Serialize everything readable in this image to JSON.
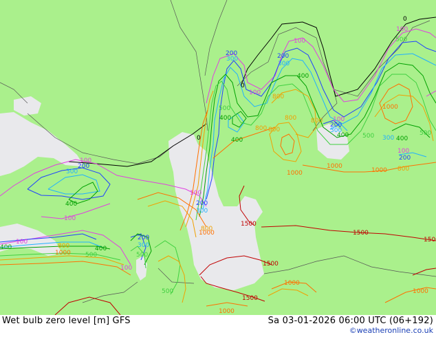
{
  "footer": {
    "product": "Wet bulb zero level [m] GFS",
    "datetime": "Sa 03-01-2026 06:00 UTC (06+192)",
    "credit": "©weatheronline.co.uk"
  },
  "colors": {
    "land": "#aaf08c",
    "sea": "#e9e9ec",
    "border": "#555555",
    "c0": "#000000",
    "c100": "#e040e0",
    "c200": "#2040ff",
    "c300": "#20b0ff",
    "c400": "#00a000",
    "c500": "#40d040",
    "c800": "#f0a000",
    "c1000": "#ff7000",
    "c1500": "#c00000"
  },
  "contour_labels": [
    {
      "text": "0",
      "level": "c0"
    },
    {
      "text": "0",
      "level": "c0"
    },
    {
      "text": "0",
      "level": "c0"
    },
    {
      "text": "100",
      "level": "c100"
    },
    {
      "text": "100",
      "level": "c100"
    },
    {
      "text": "100",
      "level": "c100"
    },
    {
      "text": "100",
      "level": "c100"
    },
    {
      "text": "100",
      "level": "c100"
    },
    {
      "text": "100",
      "level": "c100"
    },
    {
      "text": "100",
      "level": "c100"
    },
    {
      "text": "100",
      "level": "c100"
    },
    {
      "text": "100",
      "level": "c100"
    },
    {
      "text": "100",
      "level": "c100"
    },
    {
      "text": "200",
      "level": "c200"
    },
    {
      "text": "200",
      "level": "c200"
    },
    {
      "text": "200",
      "level": "c200"
    },
    {
      "text": "200",
      "level": "c200"
    },
    {
      "text": "200",
      "level": "c200"
    },
    {
      "text": "200",
      "level": "c200"
    },
    {
      "text": "200",
      "level": "c200"
    },
    {
      "text": "300",
      "level": "c300"
    },
    {
      "text": "300",
      "level": "c300"
    },
    {
      "text": "300",
      "level": "c300"
    },
    {
      "text": "300",
      "level": "c300"
    },
    {
      "text": "300",
      "level": "c300"
    },
    {
      "text": "300",
      "level": "c300"
    },
    {
      "text": "300",
      "level": "c300"
    },
    {
      "text": "400",
      "level": "c400"
    },
    {
      "text": "400",
      "level": "c400"
    },
    {
      "text": "400",
      "level": "c400"
    },
    {
      "text": "400",
      "level": "c400"
    },
    {
      "text": "400",
      "level": "c400"
    },
    {
      "text": "400",
      "level": "c400"
    },
    {
      "text": "400",
      "level": "c400"
    },
    {
      "text": "400",
      "level": "c400"
    },
    {
      "text": "500",
      "level": "c500"
    },
    {
      "text": "500",
      "level": "c500"
    },
    {
      "text": "500",
      "level": "c500"
    },
    {
      "text": "500",
      "level": "c500"
    },
    {
      "text": "500",
      "level": "c500"
    },
    {
      "text": "500",
      "level": "c500"
    },
    {
      "text": "500",
      "level": "c500"
    },
    {
      "text": "800",
      "level": "c800"
    },
    {
      "text": "800",
      "level": "c800"
    },
    {
      "text": "800",
      "level": "c800"
    },
    {
      "text": "800",
      "level": "c800"
    },
    {
      "text": "800",
      "level": "c800"
    },
    {
      "text": "800",
      "level": "c800"
    },
    {
      "text": "800",
      "level": "c800"
    },
    {
      "text": "800",
      "level": "c800"
    },
    {
      "text": "1000",
      "level": "c1000"
    },
    {
      "text": "1000",
      "level": "c1000"
    },
    {
      "text": "1000",
      "level": "c1000"
    },
    {
      "text": "1000",
      "level": "c1000"
    },
    {
      "text": "1000",
      "level": "c1000"
    },
    {
      "text": "1000",
      "level": "c1000"
    },
    {
      "text": "1000",
      "level": "c1000"
    },
    {
      "text": "1000",
      "level": "c1000"
    },
    {
      "text": "1000",
      "level": "c1000"
    },
    {
      "text": "1500",
      "level": "c1500"
    },
    {
      "text": "1500",
      "level": "c1500"
    },
    {
      "text": "1500",
      "level": "c1500"
    },
    {
      "text": "1500",
      "level": "c1500"
    },
    {
      "text": "1500",
      "level": "c1500"
    }
  ]
}
